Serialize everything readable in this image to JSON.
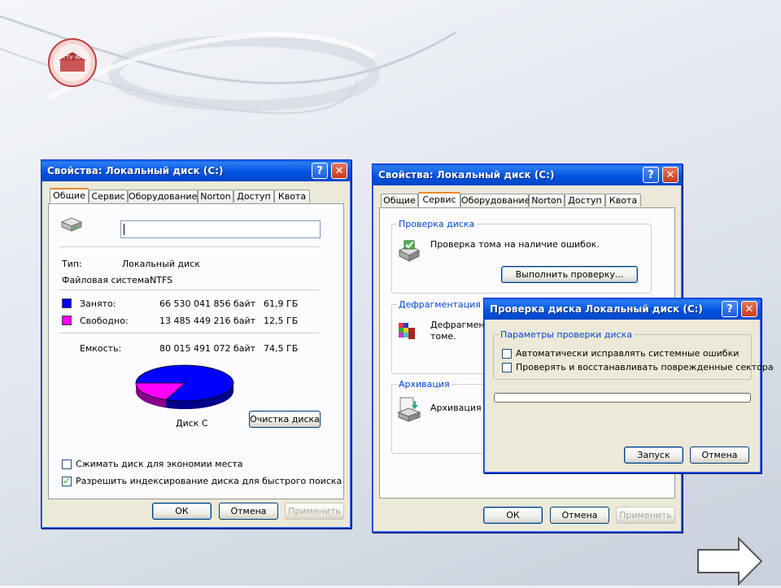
{
  "logo": {
    "text": "НТТУ-ЯНУ"
  },
  "win1": {
    "title": "Свойства: Локальный диск (C:)",
    "tabs": [
      "Общие",
      "Сервис",
      "Оборудование",
      "Norton",
      "Доступ",
      "Квота"
    ],
    "label_value": "",
    "type_label": "Тип:",
    "type_value": "Локальный диск",
    "fs_label": "Файловая система:",
    "fs_value": "NTFS",
    "used_label": "Занято:",
    "used_bytes": "66 530 041 856 байт",
    "used_gb": "61,9 ГБ",
    "free_label": "Свободно:",
    "free_bytes": "13 485 449 216 байт",
    "free_gb": "12,5 ГБ",
    "capacity_label": "Емкость:",
    "capacity_bytes": "80 015 491 072 байт",
    "capacity_gb": "74,5 ГБ",
    "disk_label": "Диск C",
    "cleanup_button": "Очистка диска",
    "compress_label": "Сжимать диск для экономии места",
    "compress_checked": false,
    "index_label": "Разрешить индексирование диска для быстрого поиска",
    "index_checked": true,
    "ok": "ОК",
    "cancel": "Отмена",
    "apply": "Применить"
  },
  "win2": {
    "title": "Свойства: Локальный диск (C:)",
    "tabs": [
      "Общие",
      "Сервис",
      "Оборудование",
      "Norton",
      "Доступ",
      "Квота"
    ],
    "check_group": "Проверка диска",
    "check_text": "Проверка тома на наличие ошибок.",
    "check_button": "Выполнить проверку...",
    "defrag_group": "Дефрагментация ди",
    "defrag_text_1": "Дефрагмен",
    "defrag_text_2": "томе.",
    "archive_group": "Архивация",
    "archive_text": "Архивация ф",
    "ok": "ОК",
    "cancel": "Отмена",
    "apply": "Применить"
  },
  "dialog": {
    "title": "Проверка диска Локальный диск (C:)",
    "group": "Параметры проверки диска",
    "opt1": "Автоматически исправлять системные ошибки",
    "opt1_checked": false,
    "opt2": "Проверять и восстанавливать поврежденные сектора",
    "opt2_checked": false,
    "progress": 0,
    "start": "Запуск",
    "cancel": "Отмена"
  },
  "colors": {
    "used": "#0000ff",
    "free": "#ff00ff",
    "title_blue": "#0054e3",
    "group_text": "#0046d5"
  },
  "icons": [
    "drive-icon",
    "help-icon",
    "close-icon",
    "check-disk-icon",
    "defrag-icon",
    "backup-icon",
    "next-arrow-icon"
  ]
}
